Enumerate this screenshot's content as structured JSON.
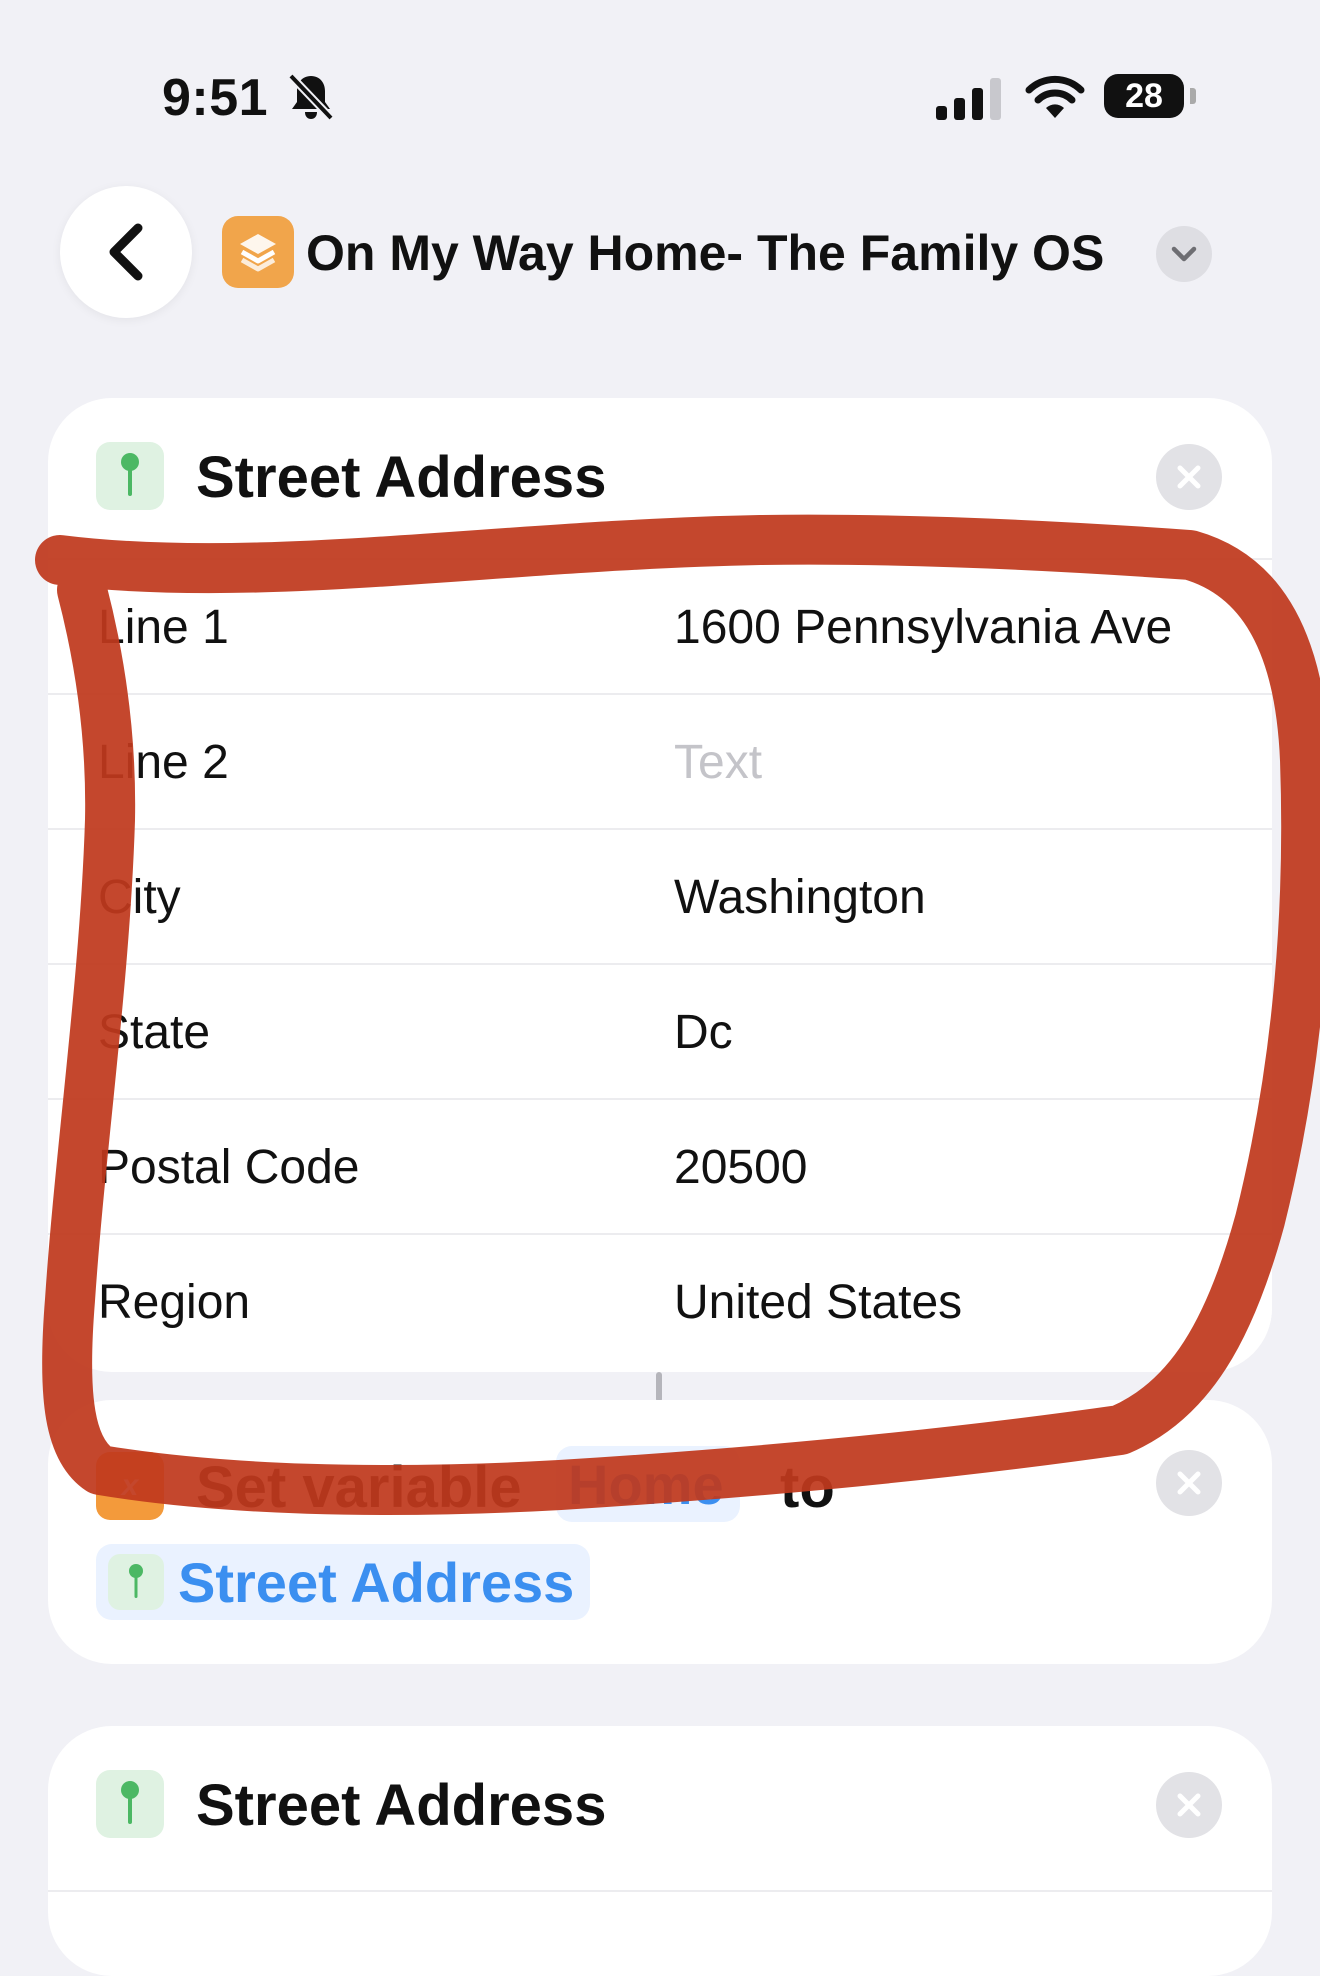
{
  "status_bar": {
    "time": "9:51",
    "battery": "28",
    "icons": [
      "bell-slash-icon",
      "cellular-signal-icon",
      "wifi-icon",
      "battery-icon"
    ]
  },
  "nav": {
    "title": "On My Way Home- The Family OS",
    "icons": [
      "back-chevron-icon",
      "shortcuts-app-icon",
      "chevron-down-icon"
    ]
  },
  "address_card": {
    "title": "Street Address",
    "icon": "map-pin-icon",
    "rows": [
      {
        "label": "Line 1",
        "value": "1600 Pennsylvania Ave",
        "placeholder": false
      },
      {
        "label": "Line 2",
        "value": "Text",
        "placeholder": true
      },
      {
        "label": "City",
        "value": "Washington",
        "placeholder": false
      },
      {
        "label": "State",
        "value": "Dc",
        "placeholder": false
      },
      {
        "label": "Postal Code",
        "value": "20500",
        "placeholder": false
      },
      {
        "label": "Region",
        "value": "United States",
        "placeholder": false
      }
    ]
  },
  "set_variable_card": {
    "action_text": "Set variable",
    "variable_name": "Home",
    "to_text": "to",
    "value_token": "Street Address",
    "icon": "variable-x-icon"
  },
  "address_card_2": {
    "title": "Street Address",
    "icon": "map-pin-icon"
  },
  "colors": {
    "background": "#f1f1f6",
    "card": "#ffffff",
    "token_blue": "#3b8ff0",
    "annotation_red": "#c0391d",
    "pin_green": "#4cb864",
    "app_orange": "#f1a54b"
  }
}
